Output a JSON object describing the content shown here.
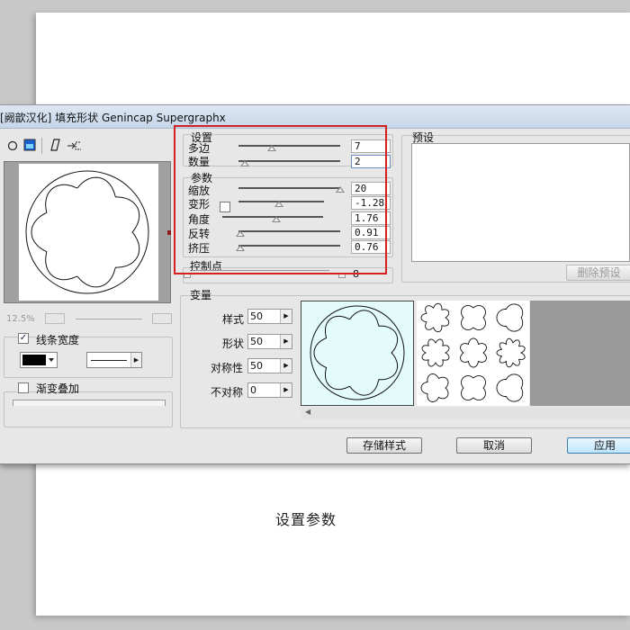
{
  "caption": "设置参数",
  "window": {
    "title": "[阙歆汉化] 填充形状 Genincap Supergraphx"
  },
  "toolbar": {
    "circle_icon": "circle-icon",
    "color_icon": "color-icon",
    "shape_icon": "shape-icon",
    "transform_icon": "transform-icon"
  },
  "zoom": {
    "value": "12.5%"
  },
  "line_width": {
    "label": "线条宽度",
    "checked": true
  },
  "gradient": {
    "label": "渐变叠加",
    "checked": false
  },
  "settings": {
    "group_label": "设置",
    "polygon": {
      "label": "多边",
      "value": "7"
    },
    "count": {
      "label": "数量",
      "value": "2"
    }
  },
  "params": {
    "group_label": "参数",
    "scale": {
      "label": "缩放",
      "value": "20"
    },
    "deform": {
      "label": "变形",
      "value": "-1.28"
    },
    "angle": {
      "label": "角度",
      "value": "1.76"
    },
    "reverse": {
      "label": "反转",
      "value": "0.91"
    },
    "squeeze": {
      "label": "挤压",
      "value": "0.76"
    }
  },
  "control_points": {
    "label": "控制点",
    "value": "8"
  },
  "presets": {
    "label": "预设",
    "delete_label": "删除预设"
  },
  "variation": {
    "label": "变量",
    "style": {
      "label": "样式",
      "value": "50"
    },
    "shape": {
      "label": "形状",
      "value": "50"
    },
    "symmetry": {
      "label": "对称性",
      "value": "50"
    },
    "asymmetry": {
      "label": "不对称",
      "value": "0"
    }
  },
  "buttons": {
    "save_style": "存储样式",
    "cancel": "取消",
    "apply": "应用"
  },
  "colors": {
    "highlight": "#d42020",
    "preview_bg": "#e4fbfb"
  }
}
